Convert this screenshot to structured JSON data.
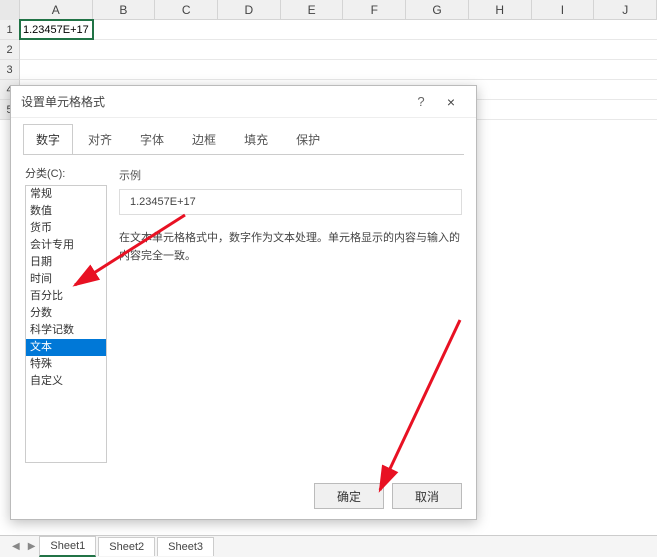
{
  "columns": [
    "A",
    "B",
    "C",
    "D",
    "E",
    "F",
    "G",
    "H",
    "I",
    "J"
  ],
  "rows": [
    "1",
    "2",
    "3",
    "4",
    "5"
  ],
  "cell_a1": "1.23457E+17",
  "sheets": {
    "s1": "Sheet1",
    "s2": "Sheet2",
    "s3": "Sheet3"
  },
  "dialog": {
    "title": "设置单元格格式",
    "help": "?",
    "close": "×",
    "tabs": {
      "t1": "数字",
      "t2": "对齐",
      "t3": "字体",
      "t4": "边框",
      "t5": "填充",
      "t6": "保护"
    },
    "category_label": "分类(C):",
    "categories": {
      "c0": "常规",
      "c1": "数值",
      "c2": "货币",
      "c3": "会计专用",
      "c4": "日期",
      "c5": "时间",
      "c6": "百分比",
      "c7": "分数",
      "c8": "科学记数",
      "c9": "文本",
      "c10": "特殊",
      "c11": "自定义"
    },
    "example_label": "示例",
    "example_value": "1.23457E+17",
    "description": "在文本单元格格式中，数字作为文本处理。单元格显示的内容与输入的内容完全一致。",
    "ok": "确定",
    "cancel": "取消"
  }
}
